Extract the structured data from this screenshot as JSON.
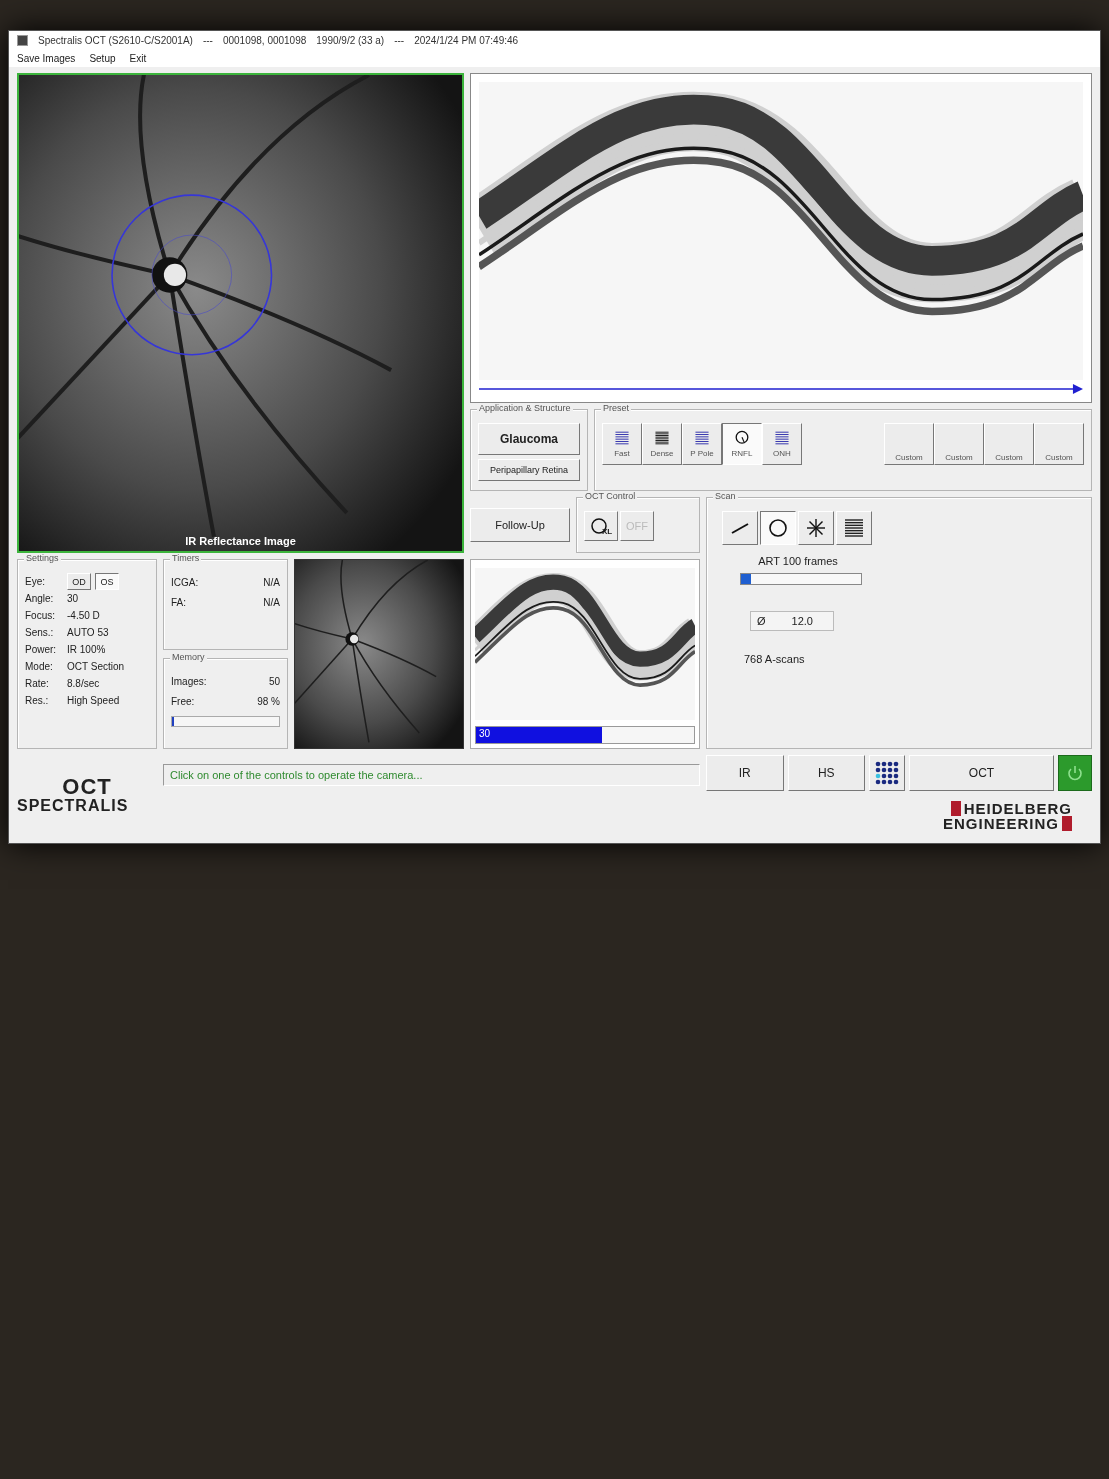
{
  "window": {
    "title": "Spectralis OCT (S2610-C/S2001A)",
    "separator_1": "---",
    "patient_id": "0001098, 0001098",
    "birth_date": "1990/9/2 (33 a)",
    "separator_2": "---",
    "datetime": "2024/1/24 PM 07:49:46"
  },
  "menu": [
    "Save Images",
    "Setup",
    "Exit"
  ],
  "ir_image": {
    "caption": "IR Reflectance Image"
  },
  "application_structure": {
    "title": "Application & Structure",
    "application": "Glaucoma",
    "structure": "Peripapillary Retina"
  },
  "preset": {
    "title": "Preset",
    "items": [
      {
        "label": "Fast",
        "kind": "raster",
        "selected": false
      },
      {
        "label": "Dense",
        "kind": "raster",
        "selected": false
      },
      {
        "label": "P Pole",
        "kind": "raster",
        "selected": false
      },
      {
        "label": "RNFL",
        "kind": "circle",
        "selected": true
      },
      {
        "label": "ONH",
        "kind": "raster",
        "selected": false
      }
    ],
    "custom": [
      "Custom",
      "Custom",
      "Custom",
      "Custom"
    ]
  },
  "follow_up": "Follow-Up",
  "oct_control": {
    "title": "OCT Control",
    "xl_label": "XL",
    "off_label": "OFF",
    "off_disabled": true
  },
  "scan": {
    "title": "Scan",
    "patterns": [
      {
        "kind": "line",
        "selected": false
      },
      {
        "kind": "circle",
        "selected": true
      },
      {
        "kind": "star",
        "selected": false
      },
      {
        "kind": "raster",
        "selected": false
      }
    ],
    "art": {
      "label": "ART 100 frames",
      "level": 0.08
    },
    "diameter_symbol": "Ø",
    "diameter": "12.0",
    "ascans": "768 A-scans"
  },
  "settings": {
    "title": "Settings",
    "eye_label": "Eye:",
    "eyes": [
      {
        "label": "OD",
        "selected": false
      },
      {
        "label": "OS",
        "selected": true
      }
    ],
    "rows": [
      {
        "label": "Angle:",
        "value": "30"
      },
      {
        "label": "Focus:",
        "value": "-4.50 D"
      },
      {
        "label": "Sens.:",
        "value": "AUTO 53"
      },
      {
        "label": "Power:",
        "value": "IR  100%"
      },
      {
        "label": "Mode:",
        "value": "OCT Section"
      },
      {
        "label": "Rate:",
        "value": "8.8/sec"
      },
      {
        "label": "Res.:",
        "value": "High Speed"
      }
    ]
  },
  "timers": {
    "title": "Timers",
    "rows": [
      {
        "label": "ICGA:",
        "value": "N/A"
      },
      {
        "label": "FA:",
        "value": "N/A"
      }
    ]
  },
  "memory": {
    "title": "Memory",
    "rows": [
      {
        "label": "Images:",
        "value": "50"
      },
      {
        "label": "Free:",
        "value": "98 %"
      }
    ],
    "usage": {
      "level": 0.02
    }
  },
  "oct_preview": {
    "progress": {
      "label": "30",
      "level": 0.58
    }
  },
  "logo": {
    "line_1": "OCT",
    "line_2": "SPECTRALIS"
  },
  "status": "Click on one of the controls to operate the camera...",
  "mode_buttons": [
    {
      "kind": "text",
      "label": "IR"
    },
    {
      "kind": "text",
      "label": "HS"
    },
    {
      "kind": "dots"
    },
    {
      "kind": "text",
      "label": "OCT"
    },
    {
      "kind": "power"
    }
  ],
  "brand": {
    "line_1": "HEIDELBERG",
    "line_2": "ENGINEERING"
  }
}
